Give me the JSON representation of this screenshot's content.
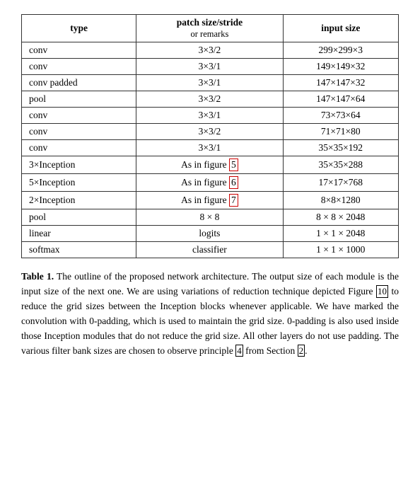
{
  "table": {
    "headers": {
      "col1": "type",
      "col2_main": "patch size/stride",
      "col2_sub": "or remarks",
      "col3": "input size"
    },
    "rows": [
      {
        "type": "conv",
        "patch": "3×3/2",
        "input": "299×299×3"
      },
      {
        "type": "conv",
        "patch": "3×3/1",
        "input": "149×149×32"
      },
      {
        "type": "conv padded",
        "patch": "3×3/1",
        "input": "147×147×32"
      },
      {
        "type": "pool",
        "patch": "3×3/2",
        "input": "147×147×64"
      },
      {
        "type": "conv",
        "patch": "3×3/1",
        "input": "73×73×64"
      },
      {
        "type": "conv",
        "patch": "3×3/2",
        "input": "71×71×80"
      },
      {
        "type": "conv",
        "patch": "3×3/1",
        "input": "35×35×192"
      },
      {
        "type": "3×Inception",
        "patch": "As in figure 5",
        "input": "35×35×288",
        "highlight": "5"
      },
      {
        "type": "5×Inception",
        "patch": "As in figure 6",
        "input": "17×17×768",
        "highlight": "6"
      },
      {
        "type": "2×Inception",
        "patch": "As in figure 7",
        "input": "8×8×1280",
        "highlight": "7"
      },
      {
        "type": "pool",
        "patch": "8 × 8",
        "input": "8 × 8 × 2048"
      },
      {
        "type": "linear",
        "patch": "logits",
        "input": "1 × 1 × 2048"
      },
      {
        "type": "softmax",
        "patch": "classifier",
        "input": "1 × 1 × 1000"
      }
    ]
  },
  "caption": {
    "label": "Table 1.",
    "text": " The outline of the proposed network architecture.  The output size of each module is the input size of the next one.  We are using variations of reduction technique depicted Figure ",
    "ref1": "10",
    "text2": " to reduce the grid sizes between the Inception blocks whenever applicable.  We have marked the convolution with 0-padding, which is used to maintain the grid size.  0-padding is also used inside those Inception modules that do not reduce the grid size.  All other layers do not use padding.  The various filter bank sizes are chosen to observe principle ",
    "ref2": "4",
    "text3": " from Section ",
    "ref3": "2",
    "text4": "."
  }
}
